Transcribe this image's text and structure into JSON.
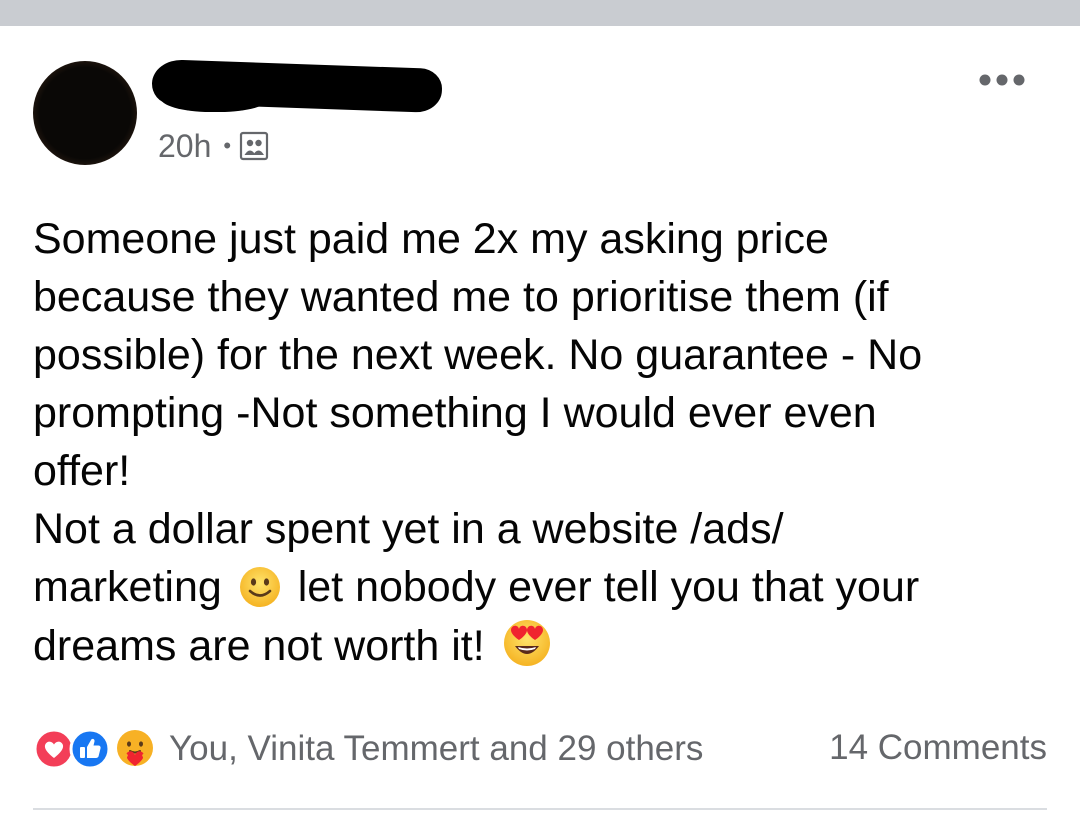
{
  "post": {
    "timestamp": "20h",
    "separator": "•",
    "audience_icon": "friends-group-icon",
    "more_icon": "more-options-icon",
    "text": {
      "line1": "Someone just paid me 2x my asking price",
      "line2": "because they wanted me to prioritise them (if",
      "line3": "possible) for the next week. No guarantee - No",
      "line4": "prompting -Not something I would ever even",
      "line5": "offer!",
      "line6": "Not a dollar spent yet in a website /ads/",
      "line7a": "marketing",
      "line7b": "let nobody ever tell you that your",
      "line8": "dreams are not worth it!"
    },
    "emojis": [
      "smiling-face-emoji",
      "heart-eyes-emoji"
    ]
  },
  "reactions": {
    "icons": [
      "love-reaction-icon",
      "like-reaction-icon",
      "care-reaction-icon"
    ],
    "summary": "You, Vinita Temmert and 29 others"
  },
  "comments": {
    "count_label": "14 Comments"
  },
  "colors": {
    "top_band": "#c9ccd1",
    "secondary_text": "#65676b",
    "like_blue": "#1877f2",
    "love_red": "#f33e58",
    "care_yellow": "#f7b125",
    "divider": "#dadde1"
  }
}
